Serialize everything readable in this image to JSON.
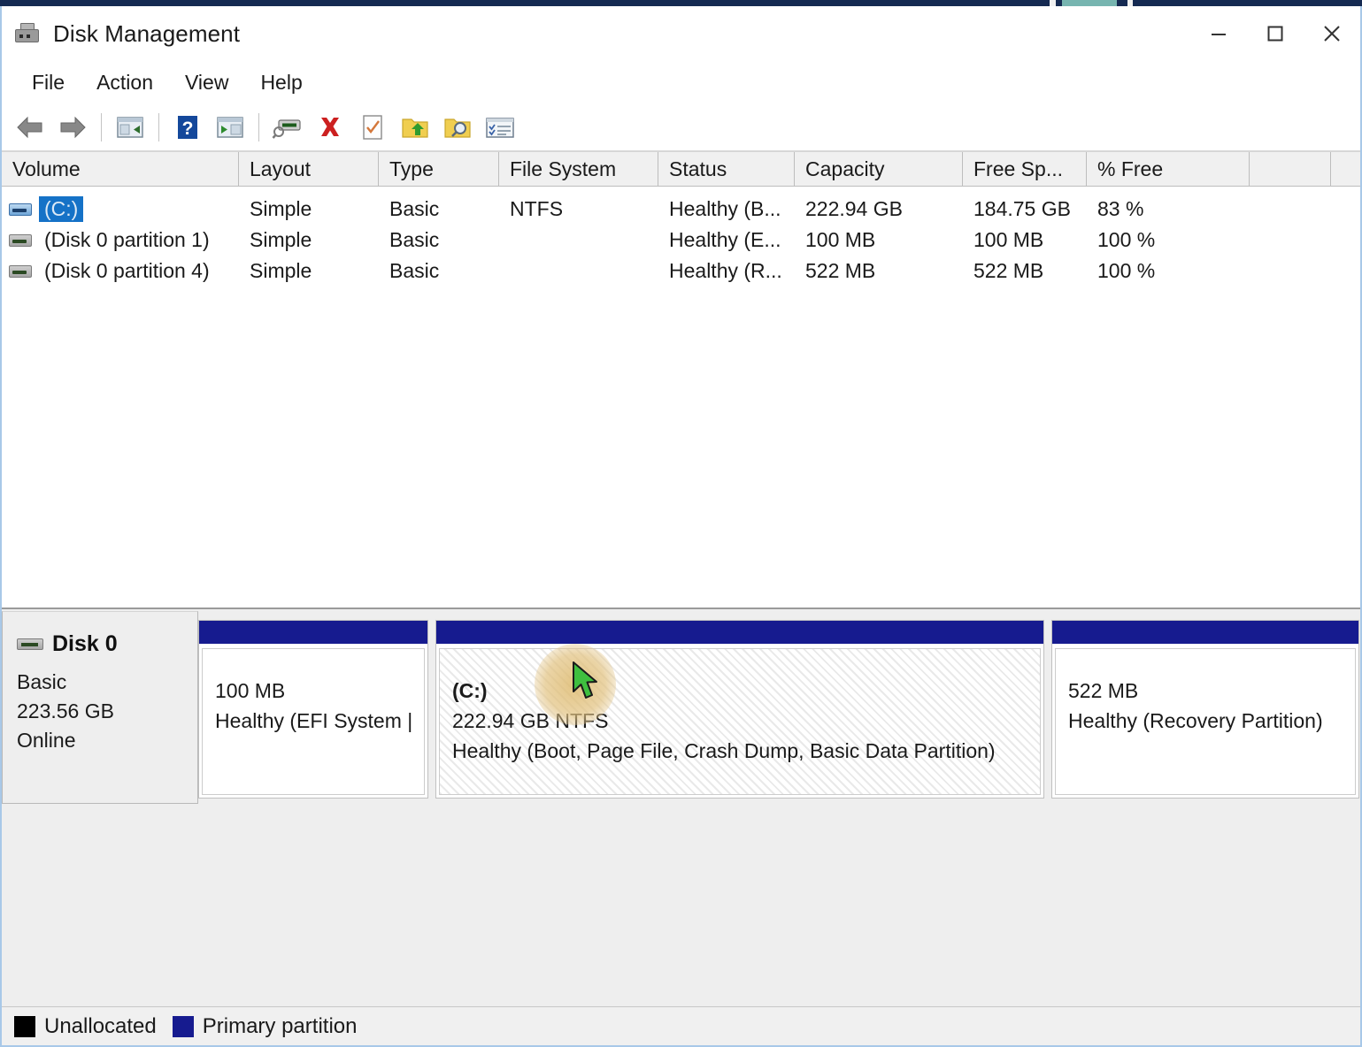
{
  "window": {
    "title": "Disk Management",
    "icon": "disk-management-icon",
    "controls": {
      "minimize": "minimize-icon",
      "maximize": "maximize-icon",
      "close": "close-icon"
    }
  },
  "menu": {
    "items": [
      {
        "label": "File"
      },
      {
        "label": "Action"
      },
      {
        "label": "View"
      },
      {
        "label": "Help"
      }
    ]
  },
  "toolbar": {
    "buttons": [
      {
        "name": "back-icon"
      },
      {
        "name": "forward-icon"
      },
      {
        "name": "show-hide-console-tree-icon"
      },
      {
        "name": "help-icon"
      },
      {
        "name": "show-hide-action-pane-icon"
      },
      {
        "name": "rescan-disks-icon"
      },
      {
        "name": "delete-icon"
      },
      {
        "name": "properties-checklist-icon"
      },
      {
        "name": "folder-up-icon"
      },
      {
        "name": "folder-search-icon"
      },
      {
        "name": "list-properties-icon"
      }
    ]
  },
  "volume_list": {
    "columns": [
      "Volume",
      "Layout",
      "Type",
      "File System",
      "Status",
      "Capacity",
      "Free Sp...",
      "% Free",
      ""
    ],
    "rows": [
      {
        "volume": "(C:)",
        "layout": "Simple",
        "type": "Basic",
        "file_system": "NTFS",
        "status": "Healthy (B...",
        "capacity": "222.94 GB",
        "free_space": "184.75 GB",
        "pct_free": "83 %",
        "selected": true
      },
      {
        "volume": "(Disk 0 partition 1)",
        "layout": "Simple",
        "type": "Basic",
        "file_system": "",
        "status": "Healthy (E...",
        "capacity": "100 MB",
        "free_space": "100 MB",
        "pct_free": "100 %",
        "selected": false
      },
      {
        "volume": "(Disk 0 partition 4)",
        "layout": "Simple",
        "type": "Basic",
        "file_system": "",
        "status": "Healthy (R...",
        "capacity": "522 MB",
        "free_space": "522 MB",
        "pct_free": "100 %",
        "selected": false
      }
    ]
  },
  "disk_graph": {
    "disk": {
      "name": "Disk 0",
      "type": "Basic",
      "size": "223.56 GB",
      "status": "Online"
    },
    "partitions": [
      {
        "label": "",
        "size": "100 MB",
        "status": "Healthy (EFI System |",
        "selected": false
      },
      {
        "label": "(C:)",
        "size": "222.94 GB NTFS",
        "status": "Healthy (Boot, Page File, Crash Dump, Basic Data Partition)",
        "selected": true
      },
      {
        "label": "",
        "size": "522 MB",
        "status": "Healthy (Recovery Partition)",
        "selected": false
      }
    ]
  },
  "legend": {
    "items": [
      {
        "label": "Unallocated",
        "color": "#000000"
      },
      {
        "label": "Primary partition",
        "color": "#161b8f"
      }
    ]
  }
}
